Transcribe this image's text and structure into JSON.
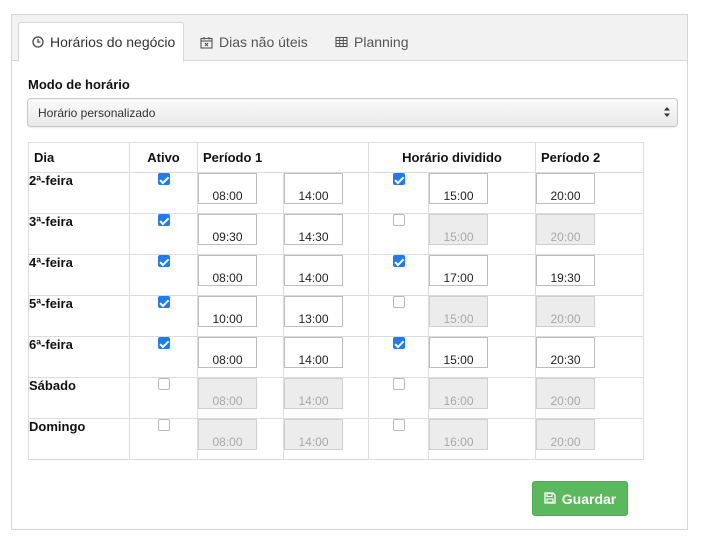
{
  "tabs": [
    {
      "label": "Horários do negócio",
      "icon": "clock-icon",
      "active": true
    },
    {
      "label": "Dias não úteis",
      "icon": "calendar-x-icon",
      "active": false
    },
    {
      "label": "Planning",
      "icon": "table-icon",
      "active": false
    }
  ],
  "mode": {
    "label": "Modo de horário",
    "selected": "Horário personalizado"
  },
  "table": {
    "headers": {
      "day": "Dia",
      "active": "Ativo",
      "period1": "Período 1",
      "split": "Horário dividido",
      "period2": "Período 2"
    },
    "rows": [
      {
        "day": "2ª-feira",
        "active": true,
        "p1_start": "08:00",
        "p1_end": "14:00",
        "split": true,
        "p2_start": "15:00",
        "p2_end": "20:00"
      },
      {
        "day": "3ª-feira",
        "active": true,
        "p1_start": "09:30",
        "p1_end": "14:30",
        "split": false,
        "p2_start": "15:00",
        "p2_end": "20:00"
      },
      {
        "day": "4ª-feira",
        "active": true,
        "p1_start": "08:00",
        "p1_end": "14:00",
        "split": true,
        "p2_start": "17:00",
        "p2_end": "19:30"
      },
      {
        "day": "5ª-feira",
        "active": true,
        "p1_start": "10:00",
        "p1_end": "13:00",
        "split": false,
        "p2_start": "15:00",
        "p2_end": "20:00"
      },
      {
        "day": "6ª-feira",
        "active": true,
        "p1_start": "08:00",
        "p1_end": "14:00",
        "split": true,
        "p2_start": "15:00",
        "p2_end": "20:30"
      },
      {
        "day": "Sábado",
        "active": false,
        "p1_start": "08:00",
        "p1_end": "14:00",
        "split": false,
        "p2_start": "16:00",
        "p2_end": "20:00"
      },
      {
        "day": "Domingo",
        "active": false,
        "p1_start": "08:00",
        "p1_end": "14:00",
        "split": false,
        "p2_start": "16:00",
        "p2_end": "20:00"
      }
    ]
  },
  "save_button": {
    "label": "Guardar",
    "icon": "save-icon",
    "color": "#5cb85c"
  },
  "colors": {
    "checkbox_on": "#1d7cf2",
    "tab_bar": "#f2f2f2"
  }
}
